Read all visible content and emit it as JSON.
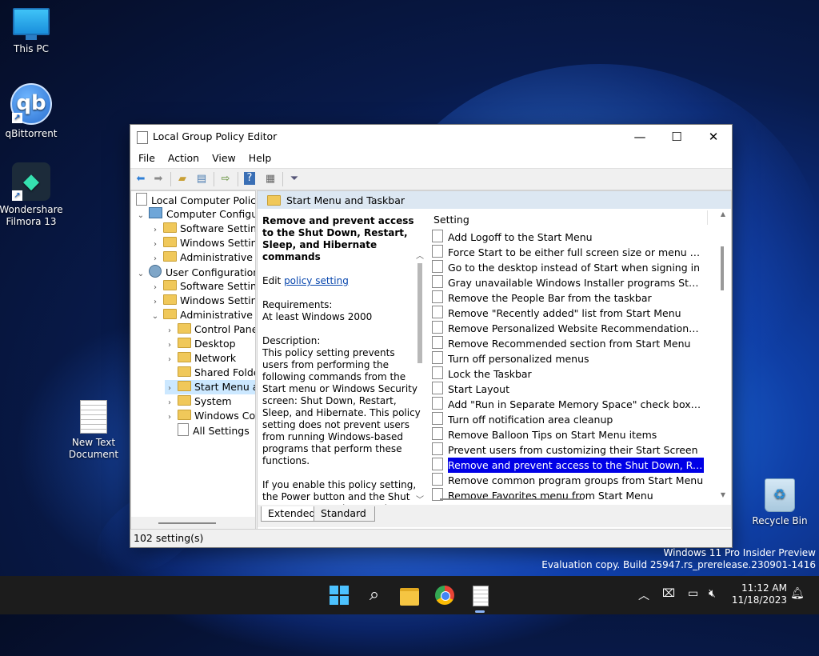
{
  "desktop": {
    "icons": [
      {
        "label": "This PC"
      },
      {
        "label": "qBittorrent",
        "glyph": "qb"
      },
      {
        "label": "Wondershare Filmora 13"
      },
      {
        "label": "New Text Document"
      },
      {
        "label": "Recycle Bin"
      }
    ]
  },
  "window": {
    "title": "Local Group Policy Editor",
    "controls": {
      "minimize": "—",
      "maximize": "☐",
      "close": "✕"
    },
    "menu": [
      "File",
      "Action",
      "View",
      "Help"
    ],
    "tree": [
      {
        "label": "Local Computer Policy"
      },
      {
        "label": "Computer Configura"
      },
      {
        "label": "Software Settings"
      },
      {
        "label": "Windows Setting"
      },
      {
        "label": "Administrative Te"
      },
      {
        "label": "User Configuration"
      },
      {
        "label": "Software Settings"
      },
      {
        "label": "Windows Setting"
      },
      {
        "label": "Administrative Te"
      },
      {
        "label": "Control Panel"
      },
      {
        "label": "Desktop"
      },
      {
        "label": "Network"
      },
      {
        "label": "Shared Folder"
      },
      {
        "label": "Start Menu ar"
      },
      {
        "label": "System"
      },
      {
        "label": "Windows Cor"
      },
      {
        "label": "All Settings"
      }
    ],
    "panel_title": "Start Menu and Taskbar",
    "description": {
      "title": "Remove and prevent access to the Shut Down, Restart, Sleep, and Hibernate commands",
      "edit_prefix": "Edit ",
      "edit_link": "policy setting",
      "requirements_label": "Requirements:",
      "requirements_value": "At least Windows 2000",
      "description_label": "Description:",
      "description_text": "This policy setting prevents users from performing the following commands from the Start menu or Windows Security screen: Shut Down, Restart, Sleep, and Hibernate. This policy setting does not prevent users from running Windows-based programs that perform these functions.",
      "enable_text": "If you enable this policy setting, the Power button and the Shut Down, Restart, Sleep, and Hibernate commands are removed from the Start menu."
    },
    "list_header": "Setting",
    "settings": [
      "Add Logoff to the Start Menu",
      "Force Start to be either full screen size or menu size",
      "Go to the desktop instead of Start when signing in",
      "Gray unavailable Windows Installer programs Start Menu sh...",
      "Remove the People Bar from the taskbar",
      "Remove \"Recently added\" list from Start Menu",
      "Remove Personalized Website Recommendations from the ...",
      "Remove Recommended section from Start Menu",
      "Turn off personalized menus",
      "Lock the Taskbar",
      "Start Layout",
      "Add \"Run in Separate Memory Space\" check box to Run dial...",
      "Turn off notification area cleanup",
      "Remove Balloon Tips on Start Menu items",
      "Prevent users from customizing their Start Screen",
      "Remove and prevent access to the Shut Down, Restart, Sleep...",
      "Remove common program groups from Start Menu",
      "Remove Favorites menu from Start Menu"
    ],
    "selected_setting_index": 15,
    "tabs": [
      "Extended",
      "Standard"
    ],
    "status": "102 setting(s)"
  },
  "watermark": {
    "line1": "Windows 11 Pro Insider Preview",
    "line2": "Evaluation copy. Build 25947.rs_prerelease.230901-1416"
  },
  "taskbar": {
    "time": "11:12 AM",
    "date": "11/18/2023"
  },
  "colors": {
    "selection": "#0000e6",
    "accent": "#4cc2ff"
  }
}
